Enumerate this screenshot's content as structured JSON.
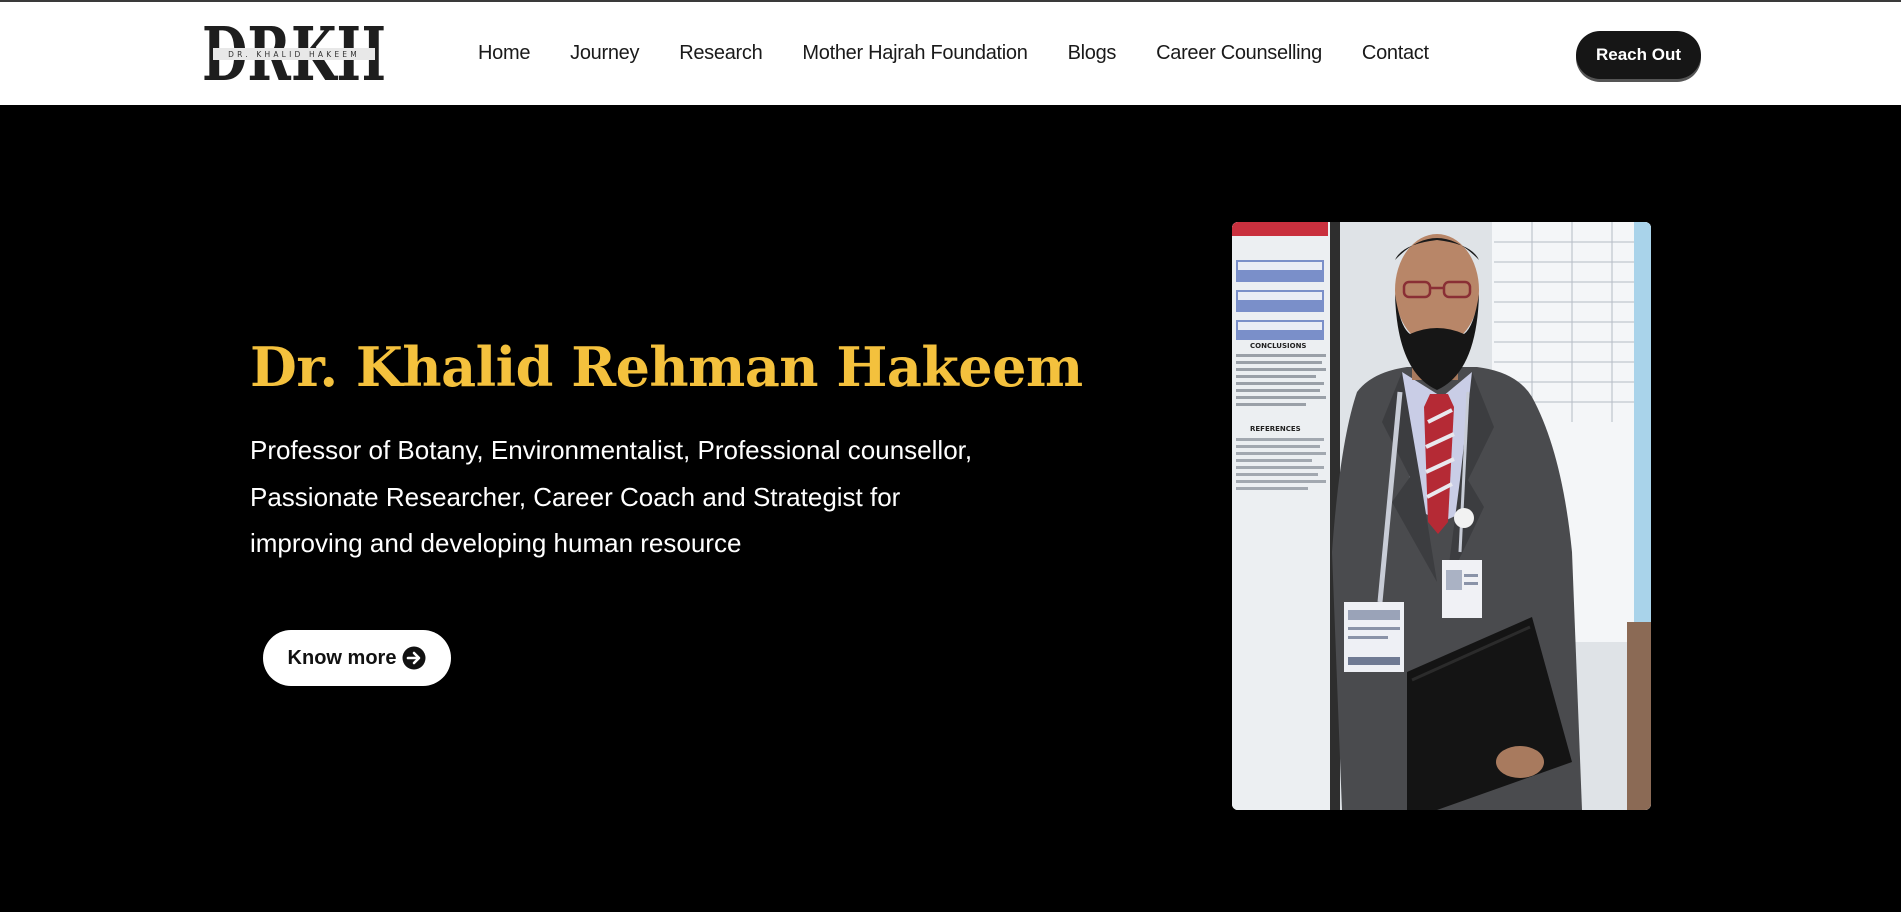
{
  "header": {
    "logo": {
      "letters": "DRKH",
      "tagline": "DR. KHALID HAKEEM"
    },
    "nav": [
      {
        "label": "Home"
      },
      {
        "label": "Journey"
      },
      {
        "label": "Research"
      },
      {
        "label": "Mother Hajrah Foundation"
      },
      {
        "label": "Blogs"
      },
      {
        "label": "Career Counselling"
      },
      {
        "label": "Contact"
      }
    ],
    "cta_label": "Reach Out"
  },
  "hero": {
    "title": "Dr. Khalid Rehman Hakeem",
    "description": "Professor of Botany, Environmentalist, Professional counsellor, Passionate Researcher, Career Coach and Strategist for improving and developing human resource",
    "button_label": "Know more",
    "button_icon": "arrow-right-circle-icon",
    "portrait": {
      "poster_headings": [
        "CONCLUSIONS",
        "REFERENCES"
      ]
    }
  },
  "colors": {
    "accent": "#f4c13d",
    "header_bg": "#ffffff",
    "hero_bg": "#000000",
    "cta_bg": "#161616"
  }
}
